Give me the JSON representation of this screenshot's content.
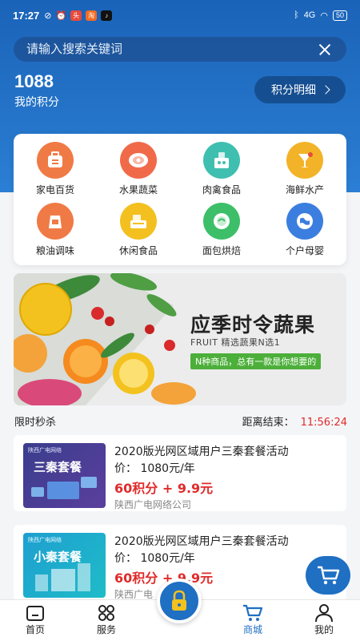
{
  "status_bar": {
    "time": "17:27",
    "battery": "50",
    "net": "4G"
  },
  "search": {
    "placeholder": "请输入搜索关键词"
  },
  "points": {
    "value": "1088",
    "label": "我的积分",
    "detail_button": "积分明细"
  },
  "categories": [
    {
      "label": "家电百货",
      "icon": "appliance-icon",
      "color": "#f07a45"
    },
    {
      "label": "水果蔬菜",
      "icon": "meat-fruit-icon",
      "color": "#f06a4a"
    },
    {
      "label": "肉禽食品",
      "icon": "food-box-icon",
      "color": "#3fbfb0"
    },
    {
      "label": "海鲜水产",
      "icon": "drink-icon",
      "color": "#f3b328"
    },
    {
      "label": "粮油调味",
      "icon": "rice-bag-icon",
      "color": "#f07a45"
    },
    {
      "label": "休闲食品",
      "icon": "snack-icon",
      "color": "#f3c020"
    },
    {
      "label": "面包烘焙",
      "icon": "bread-icon",
      "color": "#3cbf68"
    },
    {
      "label": "个户母婴",
      "icon": "globe-icon",
      "color": "#3b7ee0"
    }
  ],
  "banner": {
    "title": "应季时令蔬果",
    "subtitle": "FRUIT  精选蔬果N选1",
    "tagline": "N种商品，总有一款是你想要的"
  },
  "flash_sale": {
    "title": "限时秒杀",
    "countdown_label": "距离结束：",
    "countdown": "11:56:24"
  },
  "products": [
    {
      "title": "2020版光网区域用户三秦套餐活动",
      "price": "价：  1080元/年",
      "points_price": "60积分 + 9.9元",
      "seller": "陕西广电网络公司",
      "thumb_label": "三秦套餐",
      "thumb_tag": "陕西广电网络",
      "thumb_color": "#3a3d8c"
    },
    {
      "title": "2020版光网区域用户三秦套餐活动",
      "price": "价：  1080元/年",
      "points_price": "60积分 + 9.9元",
      "seller": "陕西广电",
      "thumb_label": "小秦套餐",
      "thumb_tag": "陕西广电网络",
      "thumb_color": "#1e9fd0"
    }
  ],
  "tabbar": [
    {
      "label": "首页",
      "icon": "home-icon"
    },
    {
      "label": "服务",
      "icon": "grid-icon"
    },
    {
      "label": "商城",
      "icon": "cart-icon",
      "active": true
    },
    {
      "label": "我的",
      "icon": "user-icon"
    }
  ],
  "colors": {
    "primary": "#1f6fc3",
    "accent_red": "#e02b2b",
    "hero": "#1a63b8"
  }
}
